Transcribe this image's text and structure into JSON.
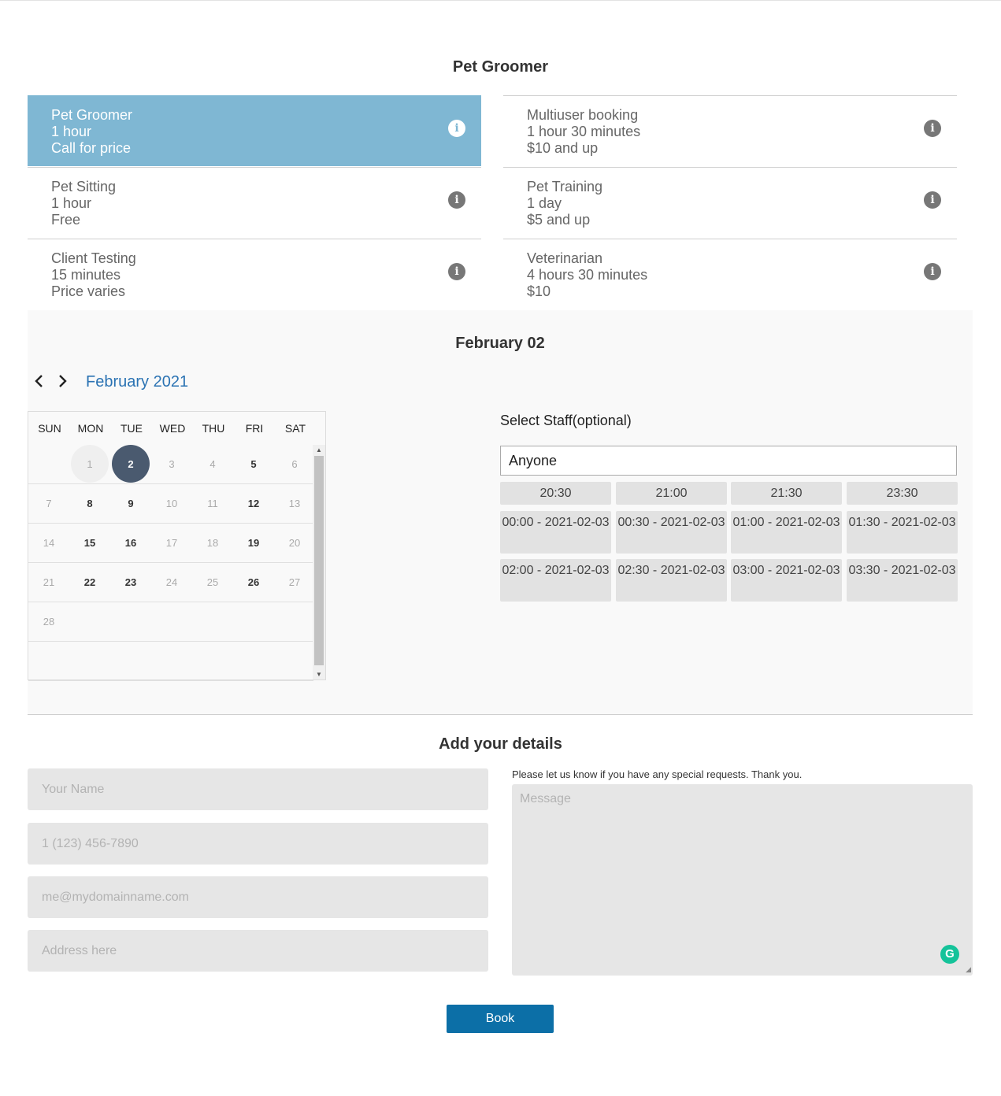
{
  "page_title": "Pet Groomer",
  "services": [
    {
      "name": "Pet Groomer",
      "duration": "1 hour",
      "price": "Call for price",
      "selected": true
    },
    {
      "name": "Multiuser booking",
      "duration": "1 hour 30 minutes",
      "price": "$10 and up"
    },
    {
      "name": "Pet Sitting",
      "duration": "1 hour",
      "price": "Free"
    },
    {
      "name": "Pet Training",
      "duration": "1 day",
      "price": "$5 and up"
    },
    {
      "name": "Client Testing",
      "duration": "15 minutes",
      "price": "Price varies"
    },
    {
      "name": "Veterinarian",
      "duration": "4 hours 30 minutes",
      "price": "$10"
    }
  ],
  "booking": {
    "selected_date_title": "February 02",
    "month_label": "February 2021",
    "prev_icon": "chevron-left-icon",
    "next_icon": "chevron-right-icon",
    "weekdays": [
      "SUN",
      "MON",
      "TUE",
      "WED",
      "THU",
      "FRI",
      "SAT"
    ],
    "weeks": [
      [
        "",
        "1",
        "2",
        "3",
        "4",
        "5",
        "6"
      ],
      [
        "7",
        "8",
        "9",
        "10",
        "11",
        "12",
        "13"
      ],
      [
        "14",
        "15",
        "16",
        "17",
        "18",
        "19",
        "20"
      ],
      [
        "21",
        "22",
        "23",
        "24",
        "25",
        "26",
        "27"
      ],
      [
        "28",
        "",
        "",
        "",
        "",
        "",
        ""
      ]
    ],
    "available_days": [
      "5",
      "8",
      "9",
      "12",
      "15",
      "16",
      "19",
      "22",
      "23",
      "26"
    ],
    "selected_day": "2",
    "today_day": "1",
    "staff_label": "Select Staff(optional)",
    "staff_value": "Anyone",
    "time_slots": [
      [
        "20:30",
        "21:00",
        "21:30",
        "23:30"
      ],
      [
        "00:00 - 2021-02-03",
        "00:30 - 2021-02-03",
        "01:00 - 2021-02-03",
        "01:30 - 2021-02-03"
      ],
      [
        "02:00 - 2021-02-03",
        "02:30 - 2021-02-03",
        "03:00 - 2021-02-03",
        "03:30 - 2021-02-03"
      ]
    ]
  },
  "details": {
    "title": "Add your details",
    "name_placeholder": "Your Name",
    "phone_placeholder": "1 (123) 456-7890",
    "email_placeholder": "me@mydomainname.com",
    "address_placeholder": "Address here",
    "message_note": "Please let us know if you have any special requests. Thank you.",
    "message_placeholder": "Message",
    "grammarly_icon": "G"
  },
  "book_button": "Book",
  "colors": {
    "selected_service": "#7fb7d3",
    "selected_day": "#4a5a6f",
    "book_button": "#0c6fa7",
    "month_link": "#2b73b3"
  }
}
